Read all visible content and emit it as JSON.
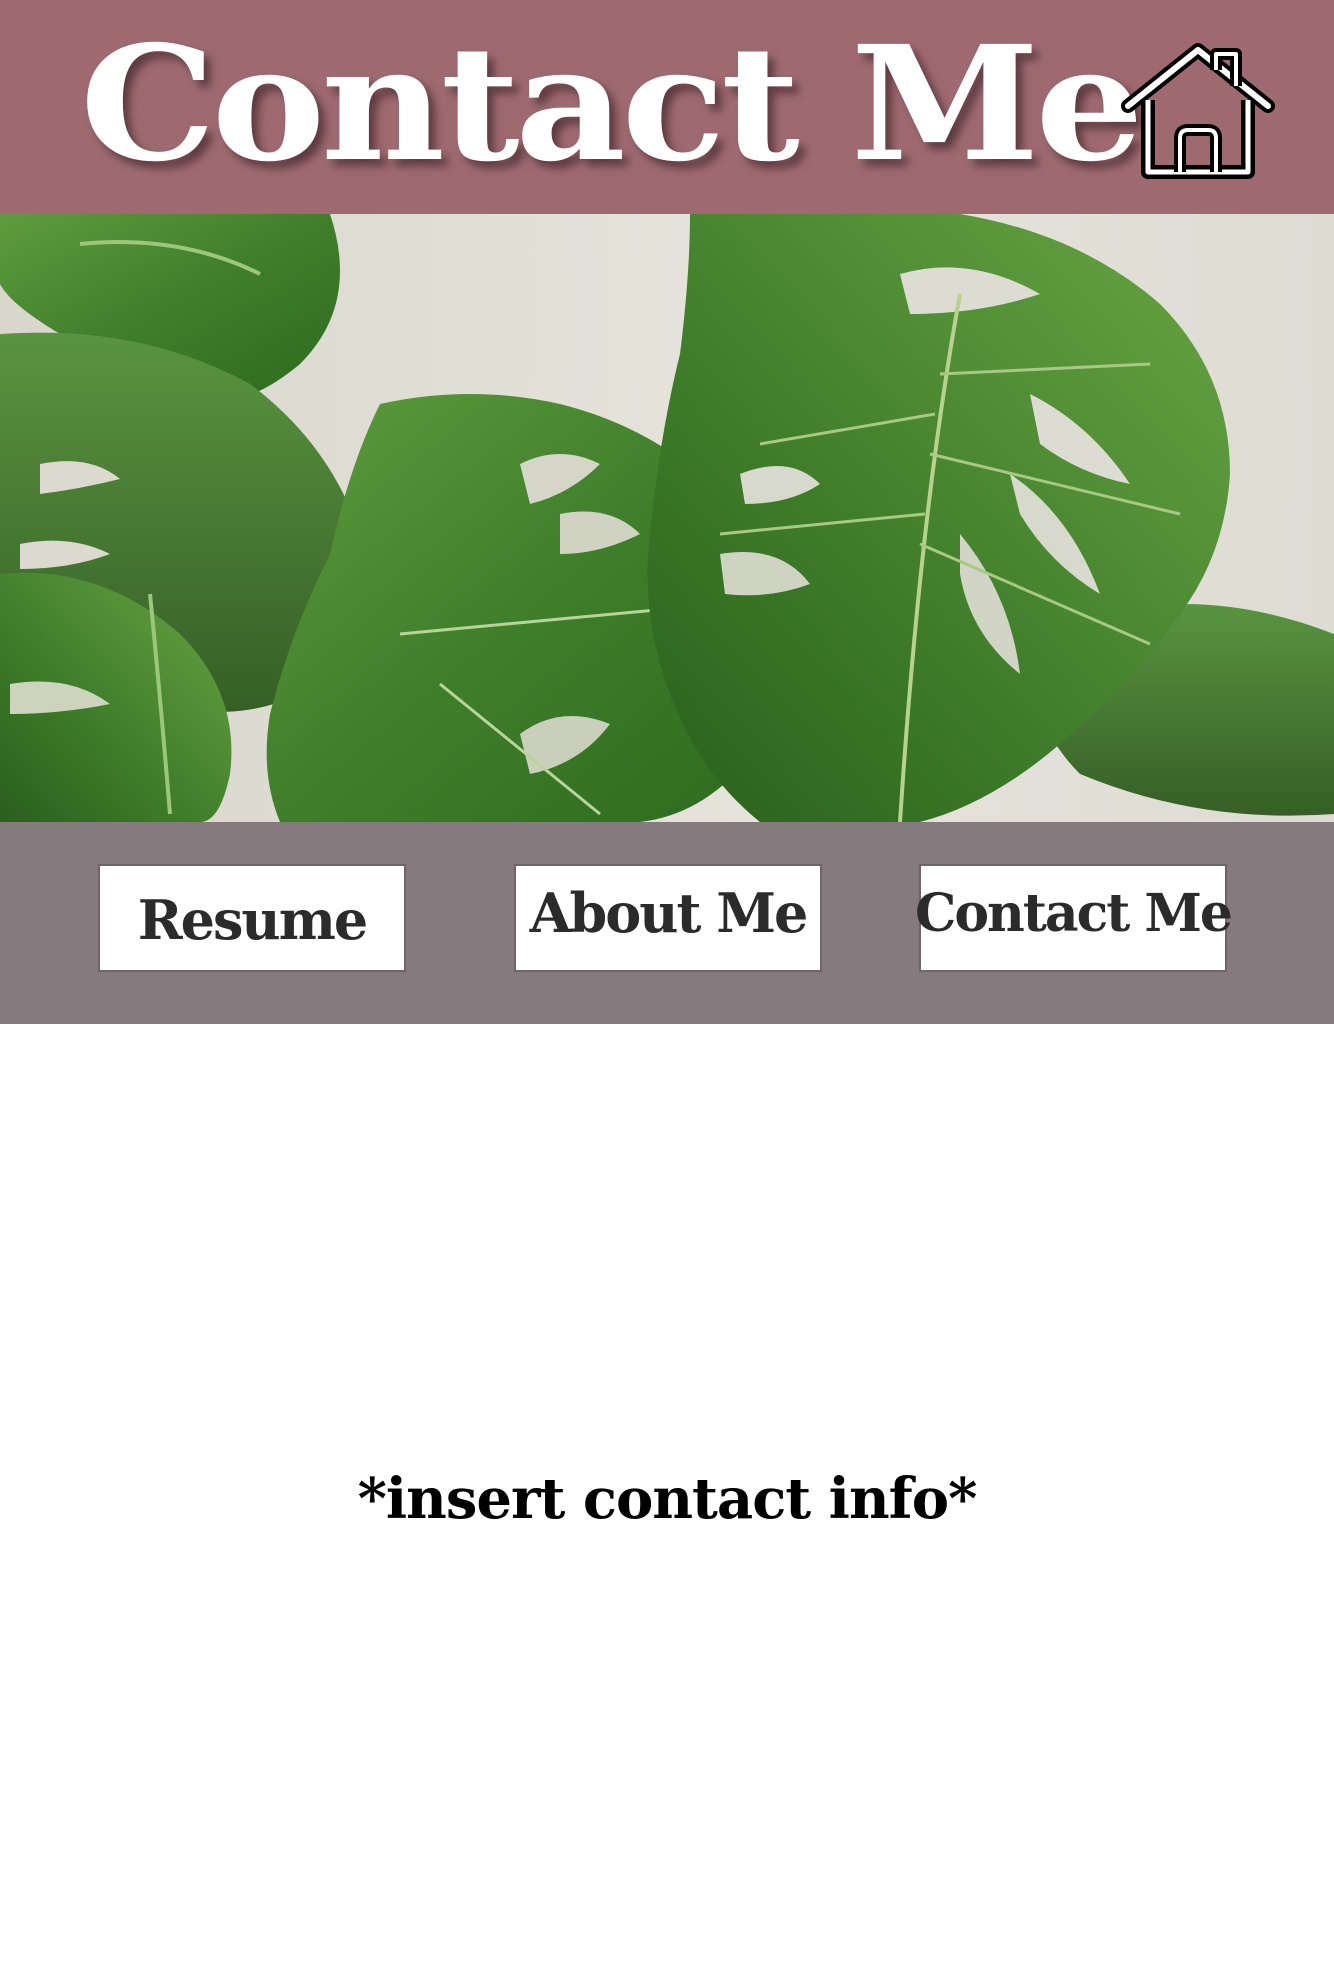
{
  "header": {
    "title": "Contact Me",
    "background_color": "#9e6a70",
    "home_icon": "home-icon"
  },
  "hero": {
    "image": "monstera-leaves-photo"
  },
  "nav": {
    "background_color": "#857a7d",
    "items": [
      {
        "label": "Resume"
      },
      {
        "label": "About Me"
      },
      {
        "label": "Contact Me"
      }
    ]
  },
  "main": {
    "contact_text": "*insert contact info*"
  }
}
